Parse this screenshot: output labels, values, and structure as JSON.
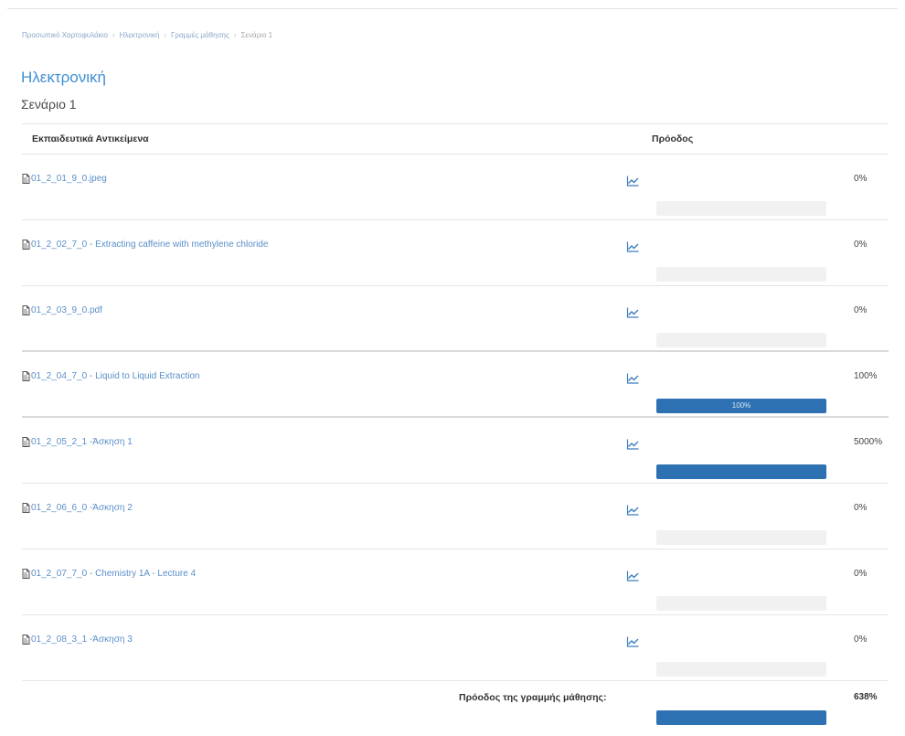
{
  "breadcrumb": [
    "Προσωπικό Χαρτοφυλάκιο",
    "Ηλεκτρονική",
    "Γραμμές μάθησης",
    "Σενάριο 1"
  ],
  "course_title": "Ηλεκτρονική",
  "section_title": "Σενάριο 1",
  "table": {
    "col_objects": "Εκπαιδευτικά Αντικείμενα",
    "col_progress": "Πρόοδος",
    "rows": [
      {
        "name": "01_2_01_9_0.jpeg",
        "progress": 0,
        "pct_text": "0%",
        "bar_text": ""
      },
      {
        "name": "01_2_02_7_0 - Extracting caffeine with methylene chloride",
        "progress": 0,
        "pct_text": "0%",
        "bar_text": ""
      },
      {
        "name": "01_2_03_9_0.pdf",
        "progress": 0,
        "pct_text": "0%",
        "bar_text": ""
      },
      {
        "name": "01_2_04_7_0 - Liquid to Liquid Extraction",
        "progress": 100,
        "pct_text": "100%",
        "bar_text": "100%"
      },
      {
        "name": "01_2_05_2_1 -Άσκηση 1",
        "progress": 100,
        "pct_text": "5000%",
        "bar_text": ""
      },
      {
        "name": "01_2_06_6_0 -Άσκηση 2",
        "progress": 0,
        "pct_text": "0%",
        "bar_text": ""
      },
      {
        "name": "01_2_07_7_0 - Chemistry 1A - Lecture 4",
        "progress": 0,
        "pct_text": "0%",
        "bar_text": ""
      },
      {
        "name": "01_2_08_3_1 -Άσκηση 3",
        "progress": 0,
        "pct_text": "0%",
        "bar_text": ""
      }
    ],
    "total_label": "Πρόοδος της γραμμής μάθησης:",
    "total_progress": 100,
    "total_pct_text": "638%"
  },
  "colors": {
    "link": "#5b8fc9",
    "title": "#3e8fd3",
    "bar_fill": "#2d71b3",
    "bar_bg": "#f1f1f1"
  },
  "icons": {
    "object": "file-icon",
    "stats": "line-chart-icon"
  }
}
